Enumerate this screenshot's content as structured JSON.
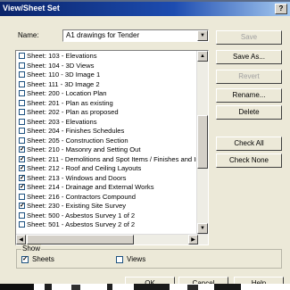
{
  "window": {
    "title": "View/Sheet Set",
    "help_label": "?",
    "close_label": "X"
  },
  "name_label": "Name:",
  "name_value": "A1 drawings for Tender",
  "list": [
    {
      "label": "Sheet: 103 - Elevations",
      "checked": false
    },
    {
      "label": "Sheet: 104 - 3D Views",
      "checked": false
    },
    {
      "label": "Sheet: 110 - 3D Image 1",
      "checked": false
    },
    {
      "label": "Sheet: 111 - 3D Image 2",
      "checked": false
    },
    {
      "label": "Sheet: 200 - Location Plan",
      "checked": false
    },
    {
      "label": "Sheet: 201 - Plan as existing",
      "checked": false
    },
    {
      "label": "Sheet: 202 - Plan as proposed",
      "checked": false
    },
    {
      "label": "Sheet: 203 - Elevations",
      "checked": false
    },
    {
      "label": "Sheet: 204 - Finishes Schedules",
      "checked": false
    },
    {
      "label": "Sheet: 205 - Construction Section",
      "checked": false
    },
    {
      "label": "Sheet: 210 - Masonry and Setting Out",
      "checked": true
    },
    {
      "label": "Sheet: 211 - Demolitions and Spot Items  /    Finishes and Int",
      "checked": true
    },
    {
      "label": "Sheet: 212 - Roof and Ceiling Layouts",
      "checked": true
    },
    {
      "label": "Sheet: 213 - Windows and Doors",
      "checked": true
    },
    {
      "label": "Sheet: 214 - Drainage and External Works",
      "checked": true
    },
    {
      "label": "Sheet: 216 - Contractors Compound",
      "checked": false
    },
    {
      "label": "Sheet: 230 - Existing Site Survey",
      "checked": true
    },
    {
      "label": "Sheet: 500 - Asbestos Survey 1 of 2",
      "checked": false
    },
    {
      "label": "Sheet: 501 - Asbestos Survey 2 of 2",
      "checked": false
    }
  ],
  "buttons": {
    "save": "Save",
    "save_as": "Save As...",
    "revert": "Revert",
    "rename": "Rename...",
    "delete": "Delete",
    "check_all": "Check All",
    "check_none": "Check None",
    "ok": "OK",
    "cancel": "Cancel",
    "help": "Help"
  },
  "show": {
    "title": "Show",
    "sheets_label": "Sheets",
    "sheets_checked": true,
    "views_label": "Views",
    "views_checked": false
  }
}
